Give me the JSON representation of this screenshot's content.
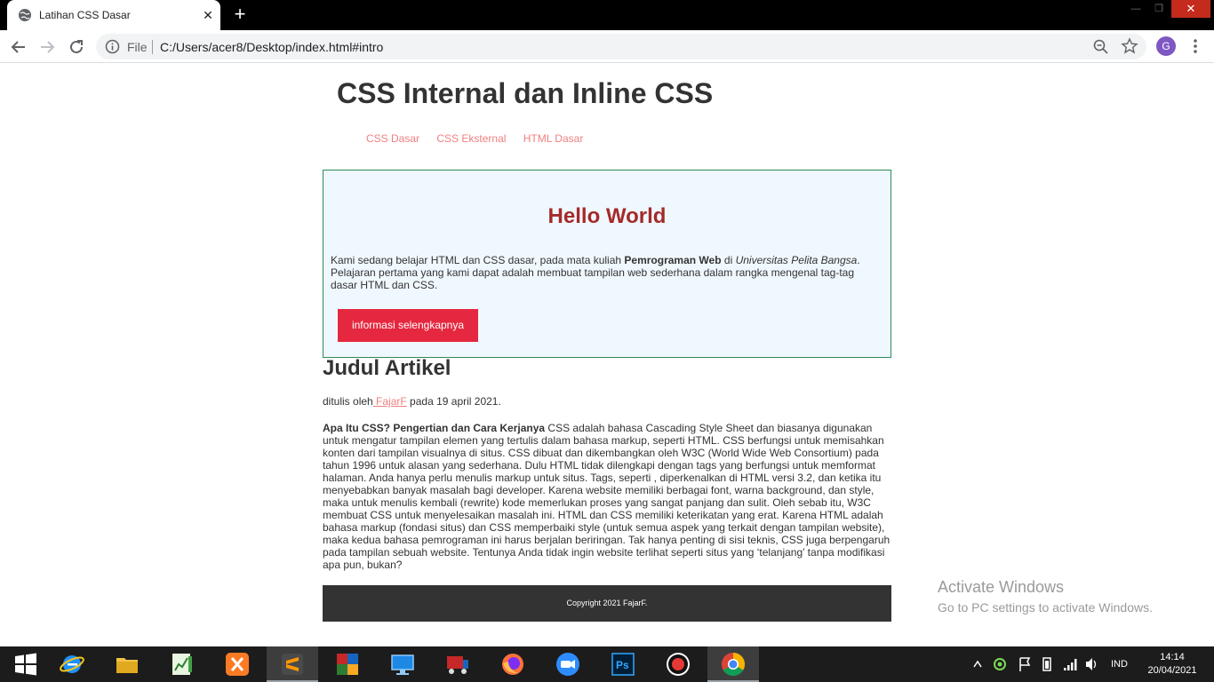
{
  "browser": {
    "tab_title": "Latihan CSS Dasar",
    "tab_close": "✕",
    "new_tab": "+",
    "scheme": "File",
    "url": "C:/Users/acer8/Desktop/index.html#intro",
    "profile_initial": "G",
    "window_controls": {
      "minimize": "—",
      "maximize": "❐",
      "close": "✕"
    }
  },
  "page": {
    "title": "CSS Internal dan Inline CSS",
    "nav": [
      {
        "label": "CSS Dasar"
      },
      {
        "label": "CSS Eksternal"
      },
      {
        "label": "HTML Dasar"
      }
    ],
    "hero": {
      "title": "Hello World",
      "text_before": "Kami sedang belajar HTML dan CSS dasar, pada mata kuliah ",
      "text_bold": "Pemrograman Web",
      "text_middle": " di ",
      "text_italic": "Universitas Pelita Bangsa",
      "text_after": ". Pelajaran pertama yang kami dapat adalah membuat tampilan web sederhana dalam rangka mengenal tag-tag dasar HTML dan CSS.",
      "button_label": "informasi selengkapnya"
    },
    "article": {
      "title": "Judul Artikel",
      "byline_prefix": "ditulis oleh",
      "author": " FajarF",
      "byline_suffix": " pada 19 april 2021.",
      "lead_bold": "Apa Itu CSS? Pengertian dan Cara Kerjanya",
      "body": " CSS adalah bahasa Cascading Style Sheet dan biasanya digunakan untuk mengatur tampilan elemen yang tertulis dalam bahasa markup, seperti HTML. CSS berfungsi untuk memisahkan konten dari tampilan visualnya di situs. CSS dibuat dan dikembangkan oleh W3C (World Wide Web Consortium) pada tahun 1996 untuk alasan yang sederhana. Dulu HTML tidak dilengkapi dengan tags yang berfungsi untuk memformat halaman. Anda hanya perlu menulis markup untuk situs. Tags, seperti , diperkenalkan di HTML versi 3.2, dan ketika itu menyebabkan banyak masalah bagi developer. Karena website memiliki berbagai font, warna background, dan style, maka untuk menulis kembali (rewrite) kode memerlukan proses yang sangat panjang dan sulit. Oleh sebab itu, W3C membuat CSS untuk menyelesaikan masalah ini. HTML dan CSS memiliki keterikatan yang erat. Karena HTML adalah bahasa markup (fondasi situs) dan CSS memperbaiki style (untuk semua aspek yang terkait dengan tampilan website), maka kedua bahasa pemrograman ini harus berjalan beriringan. Tak hanya penting di sisi teknis, CSS juga berpengaruh pada tampilan sebuah website. Tentunya Anda tidak ingin website terlihat seperti situs yang ‘telanjang’ tanpa modifikasi apa pun, bukan?"
    },
    "footer": "Copyright 2021 FajarF."
  },
  "watermark": {
    "title": "Activate Windows",
    "subtitle": "Go to PC settings to activate Windows."
  },
  "taskbar": {
    "apps": [
      {
        "name": "start-button",
        "icon": "windows-logo-icon"
      },
      {
        "name": "internet-explorer",
        "icon": "internet-explorer-icon"
      },
      {
        "name": "file-explorer",
        "icon": "folder-icon"
      },
      {
        "name": "task-app",
        "icon": "chart-notepad-icon"
      },
      {
        "name": "xampp",
        "icon": "xampp-icon"
      },
      {
        "name": "sublime-text",
        "icon": "sublime-icon"
      },
      {
        "name": "winrar",
        "icon": "winrar-icon"
      },
      {
        "name": "remote-desktop",
        "icon": "monitor-icon"
      },
      {
        "name": "truck-game",
        "icon": "truck-icon"
      },
      {
        "name": "firefox",
        "icon": "firefox-icon"
      },
      {
        "name": "zoom",
        "icon": "zoom-camera-icon"
      },
      {
        "name": "photoshop",
        "icon": "photoshop-icon"
      },
      {
        "name": "screen-recorder",
        "icon": "record-icon"
      },
      {
        "name": "chrome",
        "icon": "chrome-icon"
      }
    ],
    "language": "IND",
    "time": "14:14",
    "date": "20/04/2021"
  },
  "colors": {
    "link": "#f07f7f",
    "hero_bg": "#f0f8ff",
    "hero_border": "#2e8b57",
    "hero_title": "#a52a2a",
    "button": "#e5283f",
    "footer_bg": "#333333"
  }
}
